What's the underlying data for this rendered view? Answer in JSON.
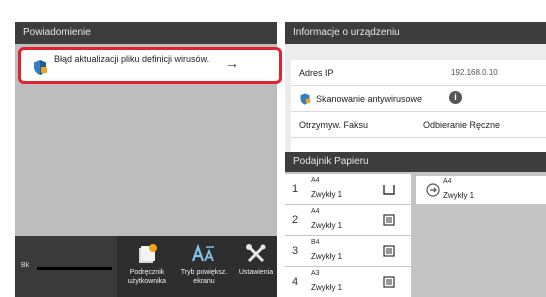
{
  "notification": {
    "header": "Powiadomienie",
    "message": "Błąd aktualizacji pliku definicji wirusów.",
    "accent": "#e2232f"
  },
  "toolbar": {
    "bk_label": "Bk",
    "tools": [
      {
        "label": "Podręcznik użytkownika",
        "icon": "user-manual-icon"
      },
      {
        "label": "Tryb powiększ. ekranu",
        "icon": "zoom-text-icon"
      },
      {
        "label": "Ustawienia",
        "icon": "settings-tools-icon"
      }
    ]
  },
  "device_info": {
    "header": "Informacje o urządzeniu",
    "ip_label": "Adres IP",
    "ip_value": "192.168.0.10",
    "antivirus_label": "Skanowanie antywirusowe",
    "fax_label": "Otrzymyw. Faksu",
    "fax_value": "Odbieranie Ręczne"
  },
  "paper_tray": {
    "header": "Podajnik Papieru",
    "trays": [
      {
        "num": "1",
        "size": "A4",
        "type": "Zwykły 1",
        "icon": "tray-open-icon"
      },
      {
        "num": "2",
        "size": "A4",
        "type": "Zwykły 1",
        "icon": "tray-stack-icon"
      },
      {
        "num": "3",
        "size": "B4",
        "type": "Zwykły 1",
        "icon": "tray-stack-icon"
      },
      {
        "num": "4",
        "size": "A3",
        "type": "Zwykły 1",
        "icon": "tray-stack-icon"
      }
    ],
    "bypass": {
      "size": "A4",
      "type": "Zwykły 1",
      "icon": "bypass-tray-icon"
    }
  }
}
